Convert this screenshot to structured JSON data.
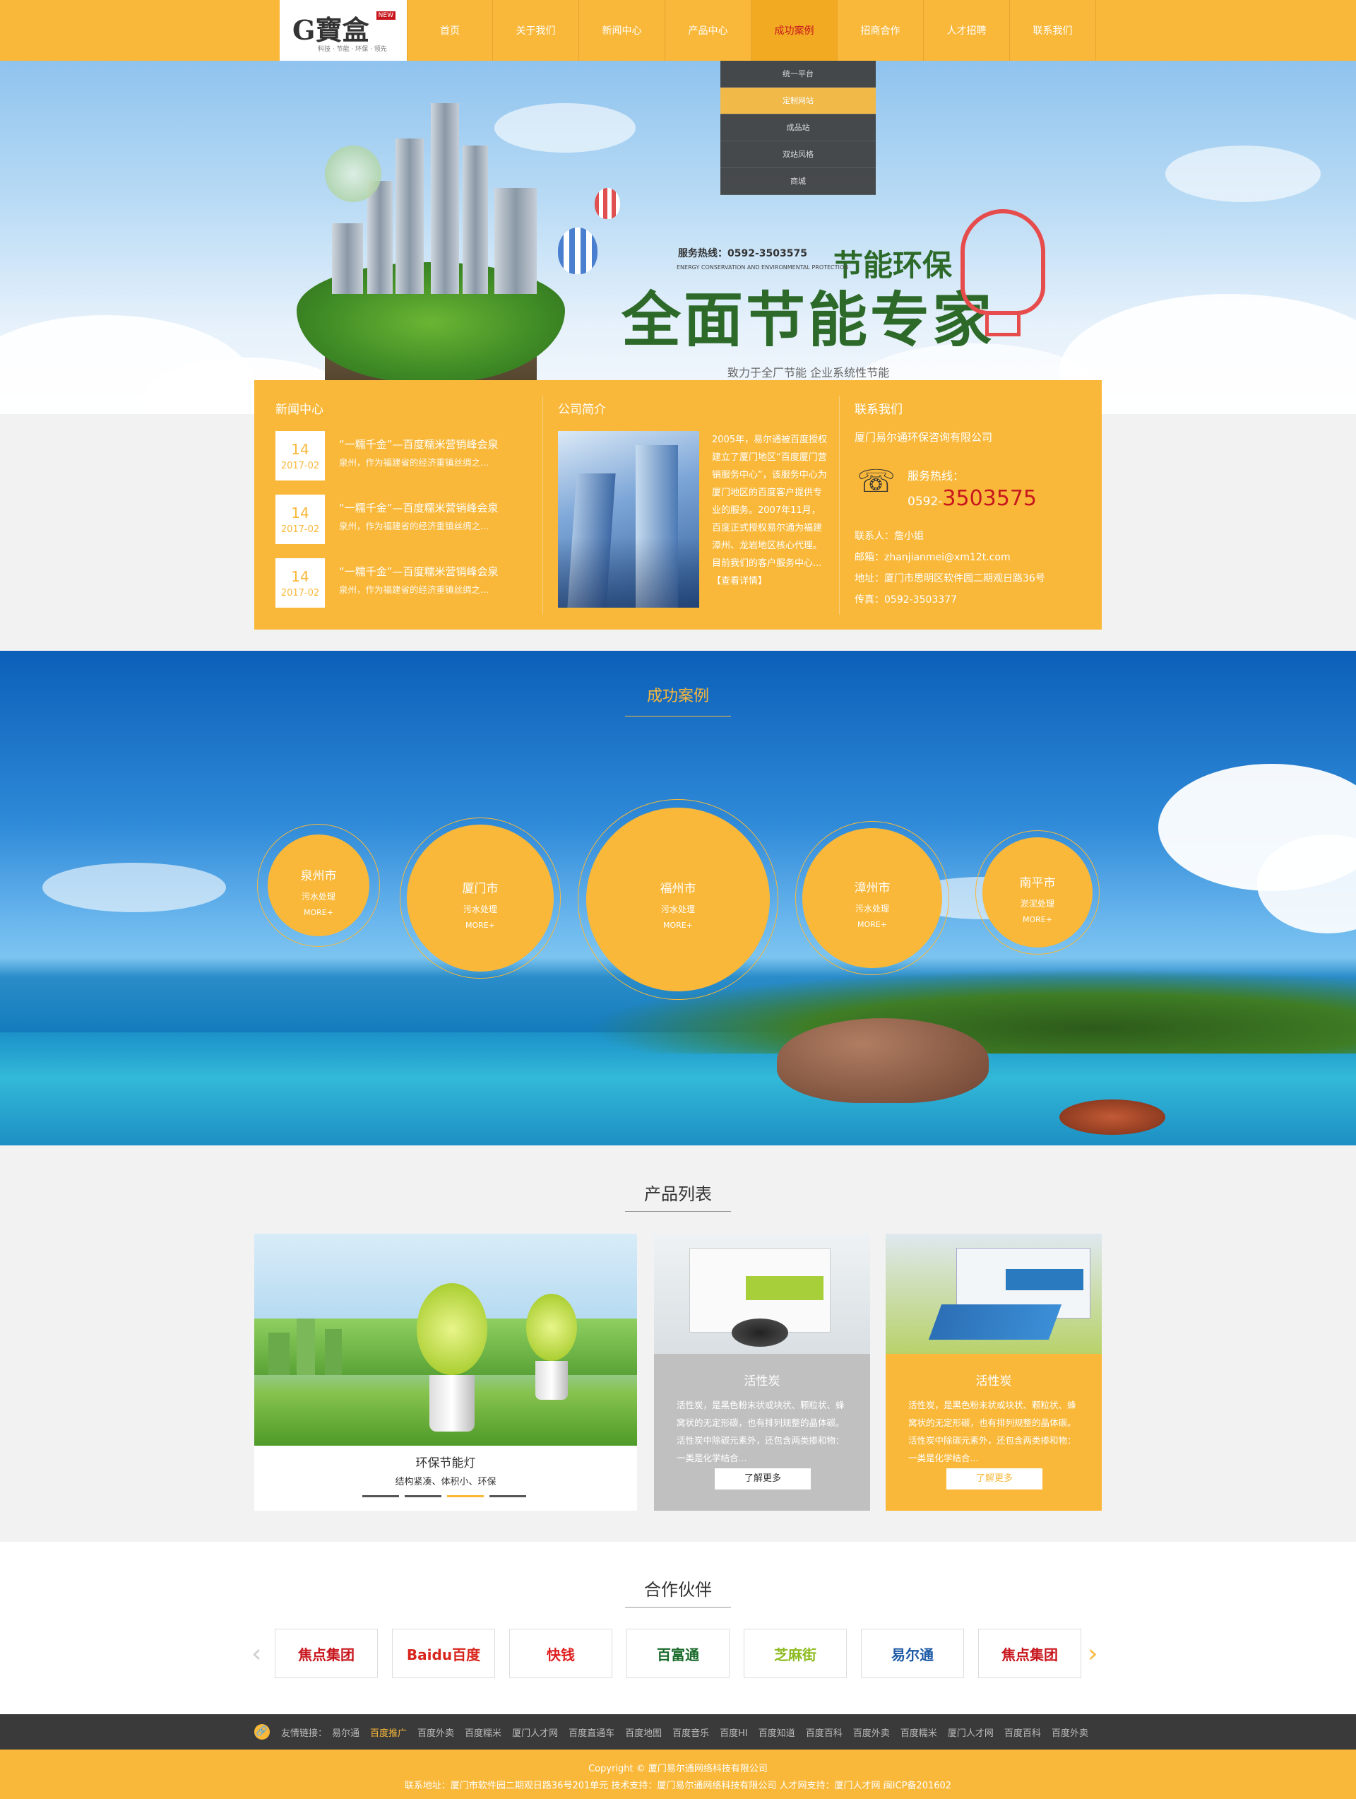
{
  "header": {
    "logo_text": "G寶盒",
    "logo_badge": "NEW",
    "logo_slogan": "科技 · 节能 · 环保 · 领先",
    "nav": [
      "首页",
      "关于我们",
      "新闻中心",
      "产品中心",
      "成功案例",
      "招商合作",
      "人才招聘",
      "联系我们"
    ],
    "active_nav": "成功案例",
    "dropdown": [
      "统一平台",
      "定制网站",
      "成品站",
      "双站风格",
      "商城"
    ],
    "dropdown_selected": "定制网站"
  },
  "banner": {
    "hotline": "服务热线：0592-3503575",
    "slogan_top": "节能环保",
    "slogan_en": "ENERGY CONSERVATION AND ENVIRONMENTAL PROTECTION",
    "slogan_main": "全面节能专家",
    "slogan_sub": "致力于全厂节能 企业系统性节能",
    "slide_count": 3,
    "active_slide": 2
  },
  "info": {
    "news_title": "新闻中心",
    "news": [
      {
        "day": "14",
        "ym": "2017-02",
        "title": "“一糯千金”—百度糯米营销峰会泉",
        "desc": "泉州，作为福建省的经济重镇丝绸之..."
      },
      {
        "day": "14",
        "ym": "2017-02",
        "title": "“一糯千金”—百度糯米营销峰会泉",
        "desc": "泉州，作为福建省的经济重镇丝绸之..."
      },
      {
        "day": "14",
        "ym": "2017-02",
        "title": "“一糯千金”—百度糯米营销峰会泉",
        "desc": "泉州，作为福建省的经济重镇丝绸之..."
      }
    ],
    "about_title": "公司简介",
    "about_text": "2005年，易尔通被百度授权建立了厦门地区“百度厦门营销服务中心”，该服务中心为厦门地区的百度客户提供专业的服务。2007年11月，百度正式授权易尔通为福建漳州、龙岩地区核心代理。目前我们的客户服务中心...",
    "about_more": "【查看详情】",
    "contact_title": "联系我们",
    "company": "厦门易尔通环保咨询有限公司",
    "hotline_label": "服务热线：",
    "hotline_prefix": "0592-",
    "hotline_number": "3503575",
    "contact_person": "联系人：詹小姐",
    "email": "邮箱：zhanjianmei@xm12t.com",
    "address": "地址：厦门市思明区软件园二期观日路36号",
    "fax": "传真：0592-3503377"
  },
  "cases": {
    "title": "成功案例",
    "items": [
      {
        "city": "泉州市",
        "service": "污水处理",
        "more": "MORE+"
      },
      {
        "city": "厦门市",
        "service": "污水处理",
        "more": "MORE+"
      },
      {
        "city": "福州市",
        "service": "污水处理",
        "more": "MORE+"
      },
      {
        "city": "漳州市",
        "service": "污水处理",
        "more": "MORE+"
      },
      {
        "city": "南平市",
        "service": "淤泥处理",
        "more": "MORE+"
      }
    ]
  },
  "products": {
    "title": "产品列表",
    "featured": {
      "name": "环保节能灯",
      "features": "结构紧凑、体积小、环保",
      "tab_count": 4,
      "active_tab": 3
    },
    "cards": [
      {
        "name": "活性炭",
        "desc": "活性炭，是黑色粉末状或块状、颗粒状、蜂窝状的无定形碳，也有排列规整的晶体碳。活性炭中除碳元素外，还包含两类掺和物：一类是化学结合...",
        "button": "了解更多"
      },
      {
        "name": "活性炭",
        "desc": "活性炭，是黑色粉末状或块状、颗粒状、蜂窝状的无定形碳，也有排列规整的晶体碳。活性炭中除碳元素外，还包含两类掺和物：一类是化学结合...",
        "button": "了解更多"
      }
    ]
  },
  "partners": {
    "title": "合作伙伴",
    "logos": [
      "焦点集团",
      "Baidu百度",
      "快钱",
      "百富通",
      "芝麻街",
      "易尔通",
      "焦点集团"
    ]
  },
  "links": {
    "label": "友情链接：",
    "items": [
      "易尔通",
      "百度推广",
      "百度外卖",
      "百度糯米",
      "厦门人才网",
      "百度直通车",
      "百度地图",
      "百度音乐",
      "百度HI",
      "百度知道",
      "百度百科",
      "百度外卖",
      "百度糯米",
      "厦门人才网",
      "百度百科",
      "百度外卖"
    ],
    "active": "百度推广"
  },
  "footer": {
    "copyright": "Copyright © 厦门易尔通网络科技有限公司",
    "line2": "联系地址：厦门市软件园二期观日路36号201单元   技术支持：厦门易尔通网络科技有限公司   人才网支持：厦门人才网   闽ICP备201602"
  },
  "colors": {
    "brand": "#f9b83a",
    "accent_red": "#c8161d",
    "dark": "#3a3a3a"
  }
}
